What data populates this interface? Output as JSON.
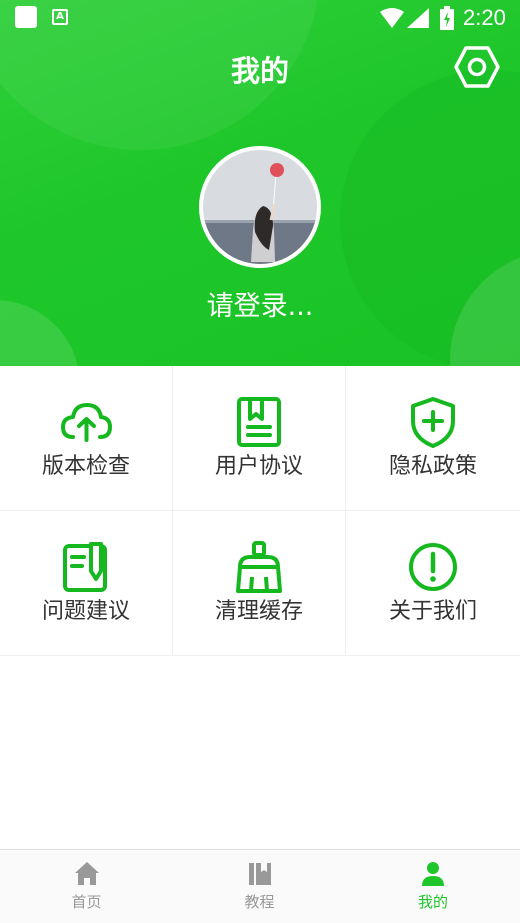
{
  "status_bar": {
    "time": "2:20"
  },
  "header": {
    "title": "我的",
    "login_text": "请登录..."
  },
  "menu": {
    "items": [
      {
        "label": "版本检查",
        "icon": "cloud-upload-icon"
      },
      {
        "label": "用户协议",
        "icon": "bookmark-document-icon"
      },
      {
        "label": "隐私政策",
        "icon": "shield-plus-icon"
      },
      {
        "label": "问题建议",
        "icon": "note-pen-icon"
      },
      {
        "label": "清理缓存",
        "icon": "broom-icon"
      },
      {
        "label": "关于我们",
        "icon": "info-exclamation-icon"
      }
    ]
  },
  "tabbar": {
    "tabs": [
      {
        "label": "首页",
        "icon": "home-icon"
      },
      {
        "label": "教程",
        "icon": "book-icon"
      },
      {
        "label": "我的",
        "icon": "person-icon"
      }
    ],
    "active_index": 2
  },
  "colors": {
    "accent": "#1ec62a",
    "icon_green": "#16b81f",
    "inactive": "#999999"
  }
}
